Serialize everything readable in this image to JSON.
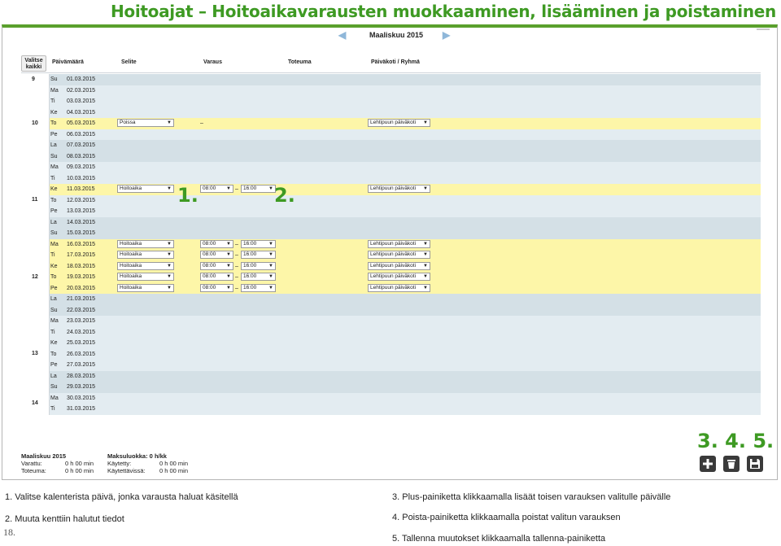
{
  "title": "Hoitoajat – Hoitoaikavarausten muokkaaminen, lisääminen ja poistaminen",
  "month_nav": {
    "label": "Maaliskuu 2015",
    "prev_icon": "arrow-left-icon",
    "next_icon": "arrow-right-icon"
  },
  "table_header": {
    "select_all_line1": "Valitse",
    "select_all_line2": "kaikki",
    "date": "Päivämäärä",
    "reason": "Selite",
    "booking": "Varaus",
    "realization": "Toteuma",
    "daycare": "Päiväkoti / Ryhmä"
  },
  "weeks": [
    {
      "num": "9"
    },
    {
      "num": "10"
    },
    {
      "num": "11"
    },
    {
      "num": "12"
    },
    {
      "num": "13"
    },
    {
      "num": "14"
    }
  ],
  "rows": [
    {
      "wd": "Su",
      "date": "01.03.2015",
      "state": "weekend"
    },
    {
      "wd": "Ma",
      "date": "02.03.2015",
      "state": "weekday"
    },
    {
      "wd": "Ti",
      "date": "03.03.2015",
      "state": "weekday"
    },
    {
      "wd": "Ke",
      "date": "04.03.2015",
      "state": "weekday"
    },
    {
      "wd": "To",
      "date": "05.03.2015",
      "state": "selected",
      "reason": "Poissa",
      "dash": "–",
      "daycare": "Lehtipuun päiväkoti"
    },
    {
      "wd": "Pe",
      "date": "06.03.2015",
      "state": "weekday"
    },
    {
      "wd": "La",
      "date": "07.03.2015",
      "state": "weekend"
    },
    {
      "wd": "Su",
      "date": "08.03.2015",
      "state": "weekend"
    },
    {
      "wd": "Ma",
      "date": "09.03.2015",
      "state": "weekday"
    },
    {
      "wd": "Ti",
      "date": "10.03.2015",
      "state": "weekday"
    },
    {
      "wd": "Ke",
      "date": "11.03.2015",
      "state": "selected",
      "reason": "Hoitoaika",
      "start": "08:00",
      "dash": "–",
      "end": "16:00",
      "daycare": "Lehtipuun päiväkoti"
    },
    {
      "wd": "To",
      "date": "12.03.2015",
      "state": "weekday"
    },
    {
      "wd": "Pe",
      "date": "13.03.2015",
      "state": "weekday"
    },
    {
      "wd": "La",
      "date": "14.03.2015",
      "state": "weekend"
    },
    {
      "wd": "Su",
      "date": "15.03.2015",
      "state": "weekend"
    },
    {
      "wd": "Ma",
      "date": "16.03.2015",
      "state": "selected",
      "reason": "Hoitoaika",
      "start": "08:00",
      "dash": "–",
      "end": "16:00",
      "daycare": "Lehtipuun päiväkoti"
    },
    {
      "wd": "Ti",
      "date": "17.03.2015",
      "state": "selected",
      "reason": "Hoitoaika",
      "start": "08:00",
      "dash": "–",
      "end": "16:00",
      "daycare": "Lehtipuun päiväkoti"
    },
    {
      "wd": "Ke",
      "date": "18.03.2015",
      "state": "selected",
      "reason": "Hoitoaika",
      "start": "08:00",
      "dash": "–",
      "end": "16:00",
      "daycare": "Lehtipuun päiväkoti"
    },
    {
      "wd": "To",
      "date": "19.03.2015",
      "state": "selected",
      "reason": "Hoitoaika",
      "start": "08:00",
      "dash": "–",
      "end": "16:00",
      "daycare": "Lehtipuun päiväkoti"
    },
    {
      "wd": "Pe",
      "date": "20.03.2015",
      "state": "selected",
      "reason": "Hoitoaika",
      "start": "08:00",
      "dash": "–",
      "end": "16:00",
      "daycare": "Lehtipuun päiväkoti"
    },
    {
      "wd": "La",
      "date": "21.03.2015",
      "state": "weekend"
    },
    {
      "wd": "Su",
      "date": "22.03.2015",
      "state": "weekend"
    },
    {
      "wd": "Ma",
      "date": "23.03.2015",
      "state": "weekday"
    },
    {
      "wd": "Ti",
      "date": "24.03.2015",
      "state": "weekday"
    },
    {
      "wd": "Ke",
      "date": "25.03.2015",
      "state": "weekday"
    },
    {
      "wd": "To",
      "date": "26.03.2015",
      "state": "weekday"
    },
    {
      "wd": "Pe",
      "date": "27.03.2015",
      "state": "weekday"
    },
    {
      "wd": "La",
      "date": "28.03.2015",
      "state": "weekend"
    },
    {
      "wd": "Su",
      "date": "29.03.2015",
      "state": "weekend"
    },
    {
      "wd": "Ma",
      "date": "30.03.2015",
      "state": "weekday"
    },
    {
      "wd": "Ti",
      "date": "31.03.2015",
      "state": "weekday"
    }
  ],
  "summary": {
    "month": "Maaliskuu 2015",
    "booked_label": "Varattu:",
    "booked_value": "0 h 00 min",
    "realized_label": "Toteuma:",
    "realized_value": "0 h 00 min",
    "fee_class": "Maksuluokka: 0 h/kk",
    "used_label": "Käytetty:",
    "used_value": "0 h 00 min",
    "available_label": "Käytettävissä:",
    "available_value": "0 h 00 min"
  },
  "step_labels": {
    "s1": "1.",
    "s2": "2.",
    "s345": "3. 4. 5."
  },
  "toolbar": {
    "add_icon": "plus-icon",
    "delete_icon": "trash-icon",
    "save_icon": "save-icon"
  },
  "instructions": {
    "i1": "1.  Valitse kalenterista päivä, jonka varausta haluat käsitellä",
    "i2": "2.  Muuta kenttiin halutut tiedot",
    "i3": "3.  Plus-painiketta klikkaamalla lisäät toisen varauksen valitulle päivälle",
    "i4": "4.  Poista-painiketta klikkaamalla poistat valitun varauksen",
    "i5": "5.  Tallenna muutokset klikkaamalla tallenna-painiketta"
  },
  "page_number": "18.",
  "colors": {
    "accent_green": "#3e9a23",
    "selected_row": "#fdf6a8",
    "weekday_row": "#e3ecf1",
    "weekend_row": "#d4e0e6"
  }
}
